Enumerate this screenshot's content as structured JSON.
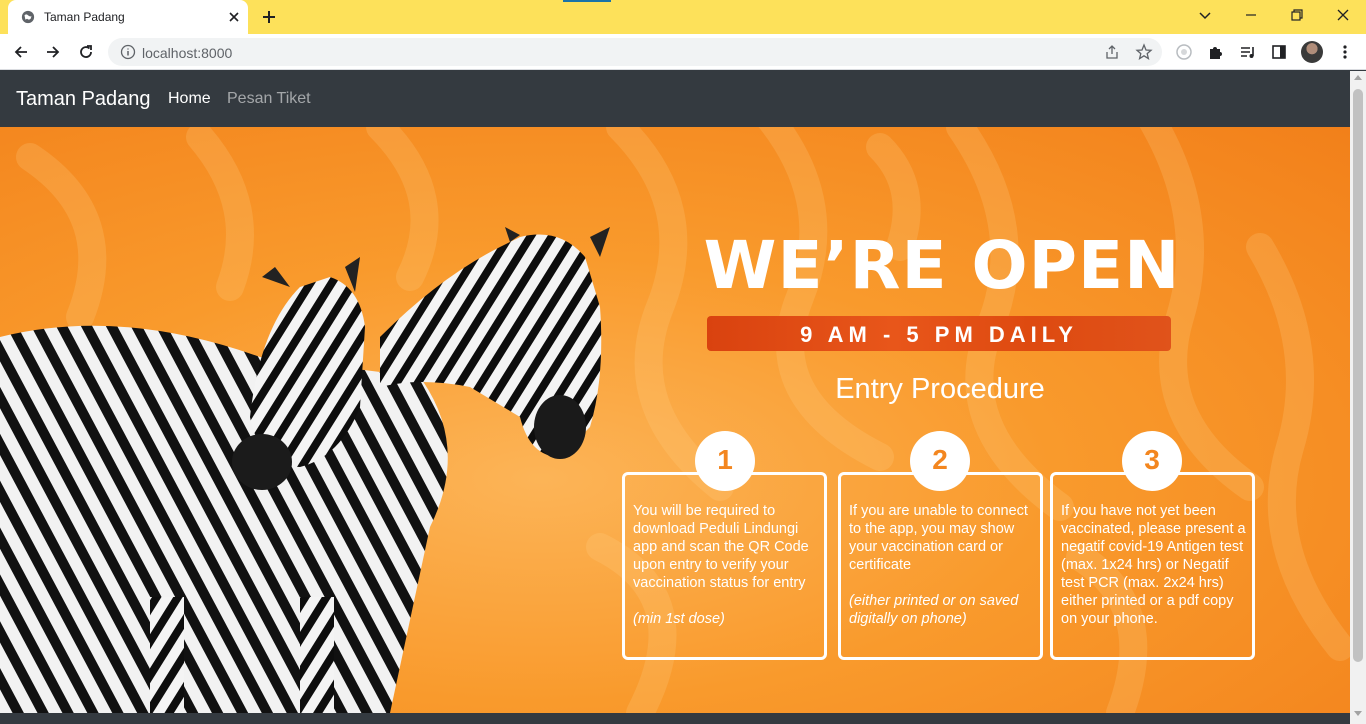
{
  "browser": {
    "tab_title": "Taman Padang",
    "url": "localhost:8000"
  },
  "navbar": {
    "brand": "Taman Padang",
    "links": [
      "Home",
      "Pesan Tiket"
    ]
  },
  "hero": {
    "headline": "WE’RE OPEN",
    "hours": "9 AM - 5 PM DAILY",
    "section_title": "Entry Procedure",
    "steps": [
      {
        "number": "1",
        "text": "You will be required to download Peduli Lindungi app and scan the QR Code upon entry to verify your vaccination status for entry",
        "note": "(min 1st dose)"
      },
      {
        "number": "2",
        "text": "If you are unable to connect to the app, you may show your vaccination card or certificate",
        "note": "(either printed or on saved digitally on phone)"
      },
      {
        "number": "3",
        "text": "If you have not yet been vaccinated, please present a negatif covid-19 Antigen test (max. 1x24 hrs) or Negatif test PCR (max. 2x24 hrs) either printed or a pdf copy on your phone.",
        "note": ""
      }
    ]
  },
  "colors": {
    "accent": "#f3861f",
    "navbar": "#343a40",
    "tabstrip": "#fde15a"
  }
}
